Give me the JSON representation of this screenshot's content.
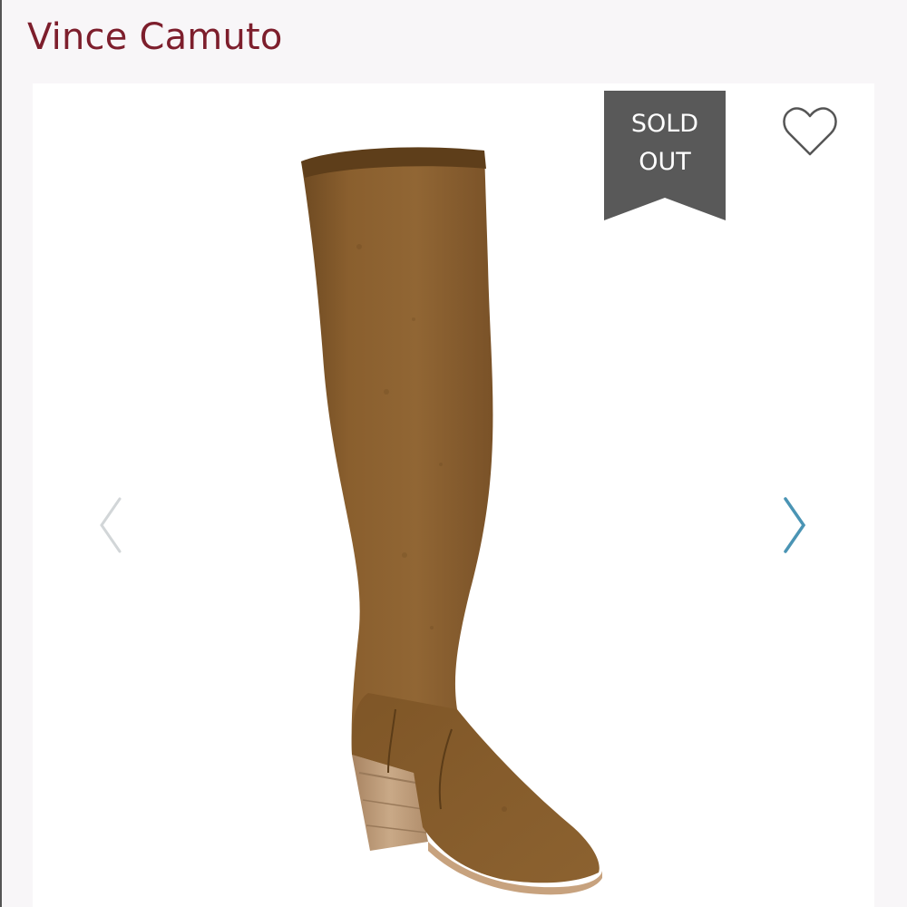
{
  "header": {
    "brand": "Vince Camuto",
    "brand_color": "#7d1e2c"
  },
  "listing": {
    "status_badge": {
      "line1": "SOLD",
      "line2": "OUT",
      "color": "#595959"
    },
    "like_icon": "heart-icon",
    "prev_icon": "chevron-left-icon",
    "next_icon": "chevron-right-icon",
    "next_arrow_color": "#4a94b4",
    "prev_arrow_color": "#d2d6d8",
    "photo_subject": "boot-photo"
  }
}
